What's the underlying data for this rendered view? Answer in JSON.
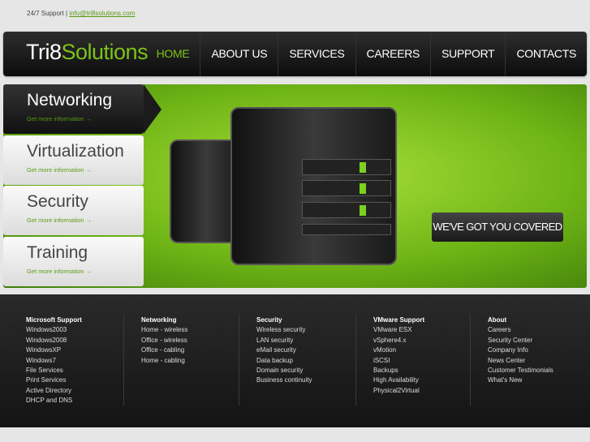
{
  "top": {
    "support": "24/7 Support | ",
    "email": "info@tri8solutions.com"
  },
  "logo": {
    "part1": "Tri8",
    "part2": "Solutions"
  },
  "nav": [
    "HOME",
    "ABOUT US",
    "SERVICES",
    "CAREERS",
    "SUPPORT",
    "CONTACTS"
  ],
  "tabs": [
    {
      "title": "Networking",
      "link": "Get more information  →"
    },
    {
      "title": "Virtualization",
      "link": "Get more information  →"
    },
    {
      "title": "Security",
      "link": "Get more information  →"
    },
    {
      "title": "Training",
      "link": "Get more information  →"
    }
  ],
  "banner": {
    "button": "WE'VE GOT YOU COVERED"
  },
  "footer": [
    {
      "title": "Microsoft Support",
      "items": [
        "Windows2003",
        "Windows2008",
        "WindowsXP",
        "Windows7",
        "File Services",
        "Print Services",
        "Active Directory",
        "DHCP and DNS"
      ]
    },
    {
      "title": "Networking",
      "items": [
        "Home - wireless",
        "Office - wireless",
        "Office - cabling",
        "Home - cabling"
      ]
    },
    {
      "title": "Security",
      "items": [
        "Wireless security",
        "LAN security",
        "eMail security",
        "Data backup",
        "Domain security",
        "Business continuity"
      ]
    },
    {
      "title": "VMware Support",
      "items": [
        "VMware ESX",
        "vSphere4.x",
        "vMotion",
        "iSCSI",
        "Backups",
        "High Availability",
        "Physical2Virtual"
      ]
    },
    {
      "title": "About",
      "items": [
        "Careers",
        "Security Center",
        "Company Info",
        "News Center",
        "Customer Testimonials",
        "What's New"
      ]
    }
  ]
}
